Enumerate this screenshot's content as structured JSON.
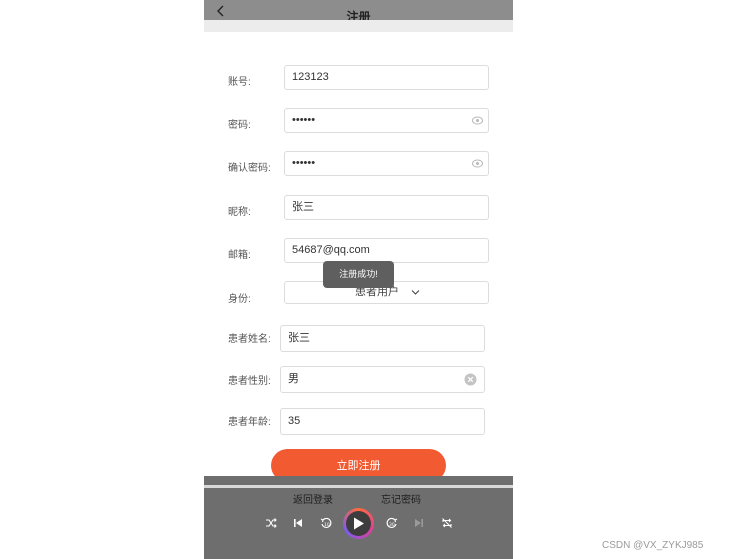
{
  "header": {
    "title": "注册"
  },
  "form": {
    "account": {
      "label": "账号:",
      "value": "123123"
    },
    "password": {
      "label": "密码:",
      "value": "••••••"
    },
    "confirm_password": {
      "label": "确认密码:",
      "value": "••••••"
    },
    "nickname": {
      "label": "昵称:",
      "value": "张三"
    },
    "email": {
      "label": "邮箱:",
      "value": "54687@qq.com"
    },
    "identity": {
      "label": "身份:",
      "value": "患者用户"
    },
    "patient_name": {
      "label": "患者姓名:",
      "value": "张三"
    },
    "patient_gender": {
      "label": "患者性别:",
      "value": "男"
    },
    "patient_age": {
      "label": "患者年龄:",
      "value": "35"
    }
  },
  "toast": "注册成功!",
  "buttons": {
    "submit": "立即注册",
    "back_to_login": "返回登录",
    "forgot_password": "忘记密码"
  },
  "watermark": "CSDN @VX_ZYKJ985",
  "colors": {
    "accent": "#f25a32",
    "overlay": "#6e6e6e"
  }
}
